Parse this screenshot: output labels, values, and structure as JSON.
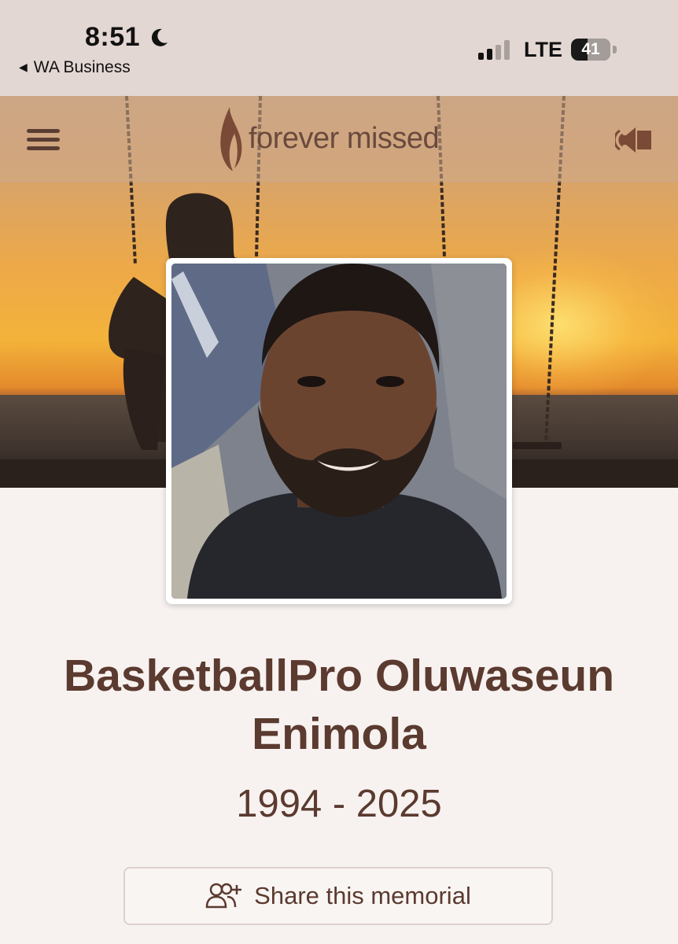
{
  "status_bar": {
    "time": "8:51",
    "back_app": "WA Business",
    "network": "LTE",
    "battery": "41",
    "battery_level": 0.41,
    "signal_bars_active": 2,
    "signal_bars_total": 4,
    "icons": [
      "moon-icon",
      "back-arrow-icon",
      "signal-icon",
      "battery-icon"
    ]
  },
  "header": {
    "brand": "forever missed",
    "menu_icon": "hamburger-menu-icon",
    "logo_icon": "flame-icon",
    "audio_icon": "speaker-icon"
  },
  "profile": {
    "name": "BasketballPro Oluwaseun Enimola",
    "years": "1994 - 2025"
  },
  "actions": {
    "share_label": "Share this memorial",
    "share_icon": "add-person-icon"
  },
  "colors": {
    "brand_brown": "#5b3a2f",
    "status_bar_bg": "#e3d7d3",
    "page_bg": "#f7f2f0"
  }
}
